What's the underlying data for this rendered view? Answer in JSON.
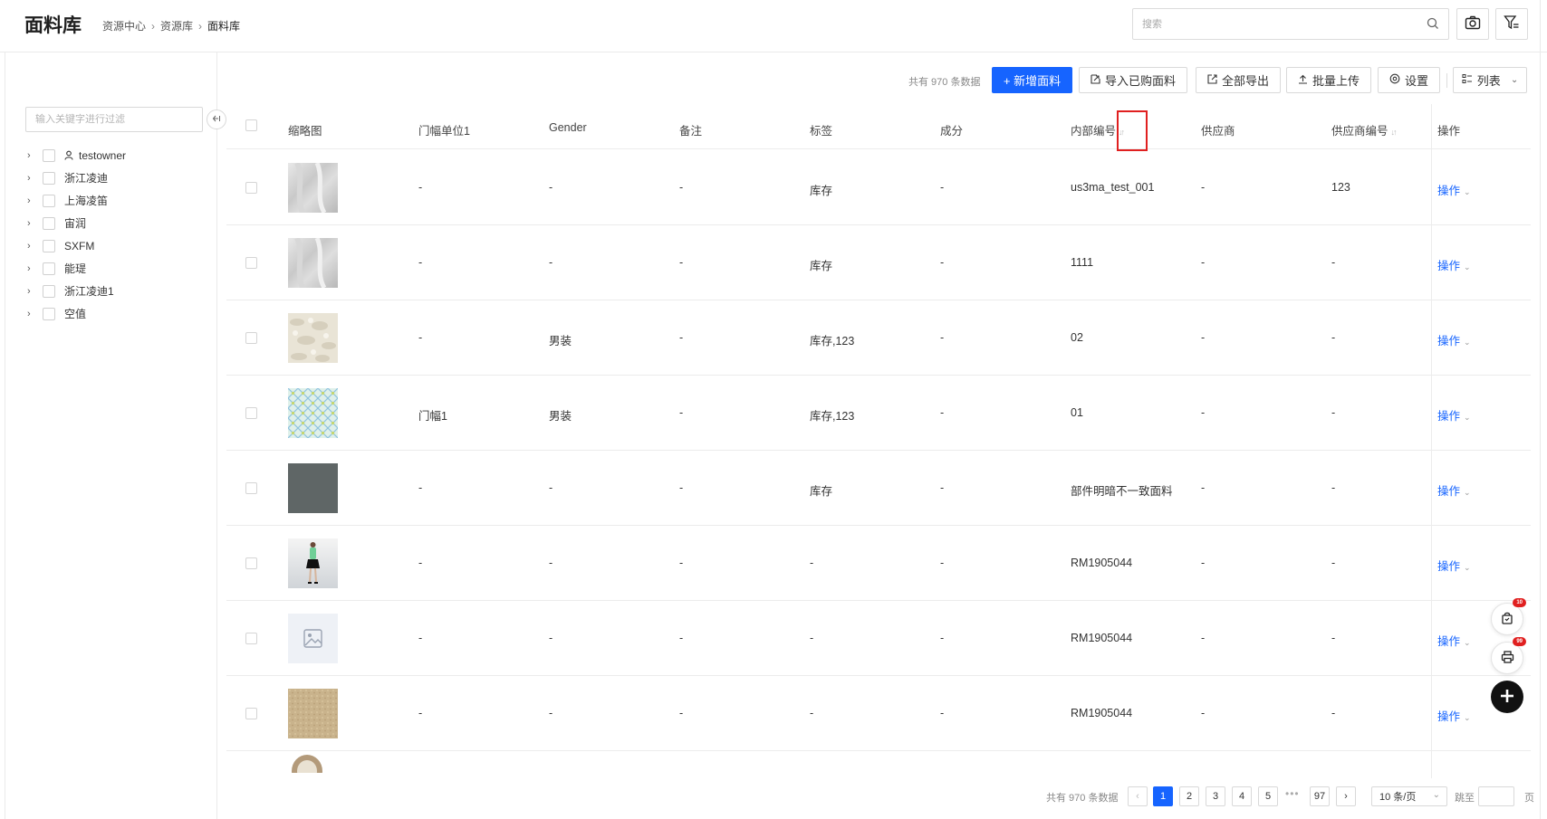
{
  "header": {
    "title": "面料库",
    "breadcrumb": [
      "资源中心",
      "资源库",
      "面料库"
    ],
    "search_placeholder": "搜索"
  },
  "toolbar": {
    "total_text": "共有 970 条数据",
    "new_label": "+ 新增面料",
    "import_label": "导入已购面料",
    "export_label": "全部导出",
    "upload_label": "批量上传",
    "settings_label": "设置",
    "view_label": "列表"
  },
  "sidebar": {
    "filter_placeholder": "输入关键字进行过滤",
    "items": [
      {
        "label": "testowner",
        "user": true
      },
      {
        "label": "浙江凌迪"
      },
      {
        "label": "上海凌笛"
      },
      {
        "label": "宙润"
      },
      {
        "label": "SXFM"
      },
      {
        "label": "能瑅"
      },
      {
        "label": "浙江凌迪1"
      },
      {
        "label": "空值"
      }
    ]
  },
  "table": {
    "columns": [
      "缩略图",
      "门幅单位1",
      "Gender",
      "备注",
      "标签",
      "成分",
      "内部编号",
      "供应商",
      "供应商编号",
      "操作"
    ],
    "rows": [
      {
        "thumb": "fabric-white-drape",
        "width": "-",
        "gender": "-",
        "note": "-",
        "tag": "库存",
        "comp": "-",
        "code": "us3ma_test_001",
        "supplier": "-",
        "supplier_code": "123",
        "op": "操作"
      },
      {
        "thumb": "fabric-white-drape",
        "width": "-",
        "gender": "-",
        "note": "-",
        "tag": "库存",
        "comp": "-",
        "code": "1111",
        "supplier": "-",
        "supplier_code": "-",
        "op": "操作"
      },
      {
        "thumb": "fabric-cream-floral",
        "width": "-",
        "gender": "男装",
        "note": "-",
        "tag": "库存,123",
        "comp": "-",
        "code": "02",
        "supplier": "-",
        "supplier_code": "-",
        "op": "操作"
      },
      {
        "thumb": "fabric-blue-pattern",
        "width": "门幅1",
        "gender": "男装",
        "note": "-",
        "tag": "库存,123",
        "comp": "-",
        "code": "01",
        "supplier": "-",
        "supplier_code": "-",
        "op": "操作"
      },
      {
        "thumb": "fabric-gray-solid",
        "width": "-",
        "gender": "-",
        "note": "-",
        "tag": "库存",
        "comp": "-",
        "code": "部件明暗不一致面料",
        "supplier": "-",
        "supplier_code": "-",
        "op": "操作"
      },
      {
        "thumb": "model-figure",
        "width": "-",
        "gender": "-",
        "note": "-",
        "tag": "-",
        "comp": "-",
        "code": "RM1905044",
        "supplier": "-",
        "supplier_code": "-",
        "op": "操作"
      },
      {
        "thumb": "image-placeholder",
        "width": "-",
        "gender": "-",
        "note": "-",
        "tag": "-",
        "comp": "-",
        "code": "RM1905044",
        "supplier": "-",
        "supplier_code": "-",
        "op": "操作"
      },
      {
        "thumb": "fabric-beige-texture",
        "width": "-",
        "gender": "-",
        "note": "-",
        "tag": "-",
        "comp": "-",
        "code": "RM1905044",
        "supplier": "-",
        "supplier_code": "-",
        "op": "操作"
      }
    ]
  },
  "pagination": {
    "total_text": "共有 970 条数据",
    "pages": [
      "1",
      "2",
      "3",
      "4",
      "5"
    ],
    "last_page": "97",
    "ellipsis": "•••",
    "page_size": "10 条/页",
    "jump_label": "跳至",
    "page_label": "页",
    "prev": "‹",
    "next": "›"
  },
  "floating": {
    "cart_badge": "10",
    "print_badge": "99"
  },
  "colors": {
    "primary": "#1664ff",
    "highlight": "#e02020"
  }
}
